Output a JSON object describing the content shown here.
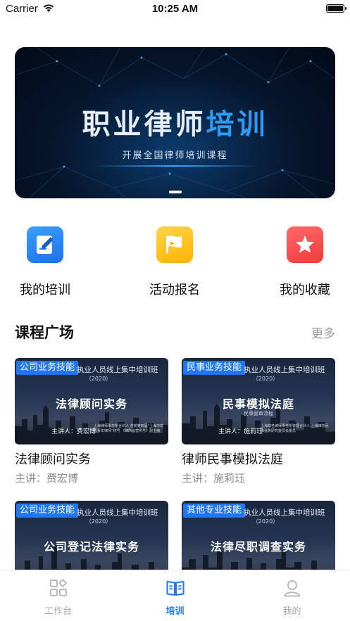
{
  "status_bar": {
    "carrier": "Carrier",
    "time": "10:25 AM"
  },
  "banner": {
    "title_white": "职业律师",
    "title_blue": "培训",
    "subtitle": "开展全国律师培训课程"
  },
  "quick_actions": [
    {
      "label": "我的培训",
      "icon": "edit-note-icon",
      "color": "#2b86f4"
    },
    {
      "label": "活动报名",
      "icon": "flag-icon",
      "color": "#ffc21f"
    },
    {
      "label": "我的收藏",
      "icon": "star-icon",
      "color": "#f24b4b"
    }
  ],
  "course_section": {
    "title": "课程广场",
    "more": "更多"
  },
  "courses": [
    {
      "tag": "公司业务技能",
      "thumb_header": "执业人员线上集中培训班",
      "thumb_year": "（2020）",
      "thumb_title": "法律顾问实务",
      "thumb_subtitle": "",
      "thumb_lecturer": "主讲人：费宏博",
      "thumb_note": "上海律师事务所合伙人 曾获第四届“上海市优秀青年律师”称号 《律所运营实务》副主编",
      "title": "法律顾问实务",
      "speaker": "主讲：费宏博"
    },
    {
      "tag": "民事业务技能",
      "thumb_header": "执业人员线上集中培训班",
      "thumb_year": "（2020）",
      "thumb_title": "民事模拟法庭",
      "thumb_subtitle": "民事庭审流程",
      "thumb_lecturer": "主讲人：施莉珏",
      "thumb_note": "上海知名律师事务所管理合伙人 上海律协民事业务研究委员会委员",
      "title": "律师民事模拟法庭",
      "speaker": "主讲：施莉珏"
    },
    {
      "tag": "公司业务技能",
      "thumb_header": "执业人员线上集中培训班",
      "thumb_year": "（2020）",
      "thumb_title": "公司登记法律实务",
      "thumb_subtitle": "",
      "thumb_lecturer": "",
      "thumb_note": "",
      "title": "",
      "speaker": ""
    },
    {
      "tag": "其他专业技能",
      "thumb_header": "执业人员线上集中培训班",
      "thumb_year": "（2020）",
      "thumb_title": "法律尽职调查实务",
      "thumb_subtitle": "",
      "thumb_lecturer": "",
      "thumb_note": "",
      "title": "",
      "speaker": ""
    }
  ],
  "tab_bar": [
    {
      "label": "工作台",
      "icon": "grid-icon",
      "active": false
    },
    {
      "label": "培训",
      "icon": "open-book-icon",
      "active": true
    },
    {
      "label": "我的",
      "icon": "user-icon",
      "active": false
    }
  ],
  "colors": {
    "accent": "#1f78f2",
    "muted": "#8c8c8c"
  }
}
